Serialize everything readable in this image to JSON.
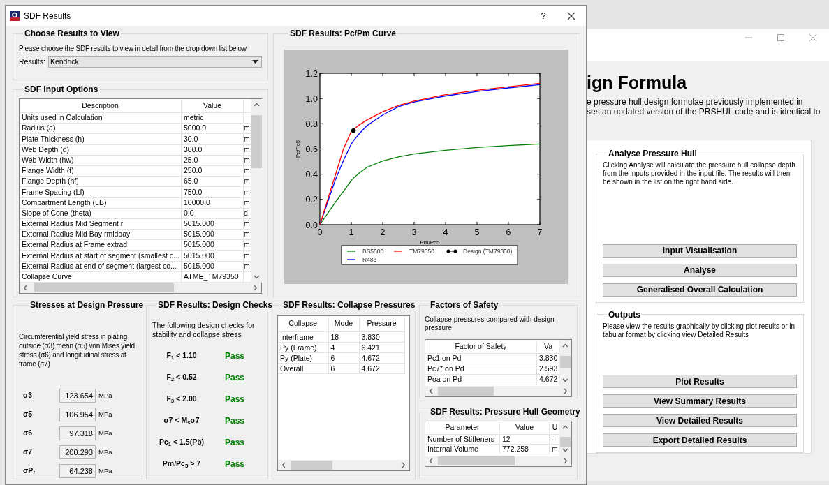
{
  "main_window": {
    "heading": "ign Formula",
    "description_lines": [
      "e pressure hull design formulae previously implemented in",
      "ses an updated version of the PRSHUL code and is identical to"
    ],
    "analyse": {
      "title": "Analyse Pressure Hull",
      "description": "Clicking Analyse will calculate the pressure hull collapse depth from the inputs provided in the input file. The results will then be shown in the list on the right hand side.",
      "buttons": [
        "Input Visualisation",
        "Analyse",
        "Generalised Overall Calculation"
      ]
    },
    "outputs": {
      "title": "Outputs",
      "description": "Please view the results graphically by clicking plot results or in tabular format by clicking view Detailed Results",
      "buttons": [
        "Plot Results",
        "View Summary Results",
        "View Detailed Results",
        "Export Detailed Results"
      ]
    }
  },
  "sdf_window": {
    "title": "SDF Results",
    "help": "?",
    "choose": {
      "title": "Choose Results to View",
      "description": "Please choose the SDF results to view in detail from the drop down list below",
      "results_label": "Results:",
      "results_value": "Kendrick"
    },
    "input_options": {
      "title": "SDF Input Options",
      "columns": [
        "Description",
        "Value"
      ],
      "rows": [
        {
          "description": "Units used in Calculation",
          "value": "metric"
        },
        {
          "description": "Radius (a)",
          "value": "5000.0",
          "unit": "m"
        },
        {
          "description": "Plate Thickness (h)",
          "value": "30.0",
          "unit": "m"
        },
        {
          "description": "Web Depth (d)",
          "value": "300.0",
          "unit": "m"
        },
        {
          "description": "Web Width (hw)",
          "value": "25.0",
          "unit": "m"
        },
        {
          "description": "Flange Width (f)",
          "value": "250.0",
          "unit": "m"
        },
        {
          "description": "Flange Depth (hf)",
          "value": "65.0",
          "unit": "m"
        },
        {
          "description": "Frame Spacing (Lf)",
          "value": "750.0",
          "unit": "m"
        },
        {
          "description": "Compartment Length (LB)",
          "value": "10000.0",
          "unit": "m"
        },
        {
          "description": "Slope of Cone (theta)",
          "value": "0.0",
          "unit": "d"
        },
        {
          "description": "External Radius Mid Segment r",
          "value": "5015.000",
          "unit": "m"
        },
        {
          "description": "External Radius Mid Bay rmidbay",
          "value": "5015.000",
          "unit": "m"
        },
        {
          "description": "External Radius at Frame extrad",
          "value": "5015.000",
          "unit": "m"
        },
        {
          "description": "External Radius at start of segment (smallest c...",
          "value": "5015.000",
          "unit": "m"
        },
        {
          "description": "External Radius at end of segment (largest co...",
          "value": "5015.000",
          "unit": "m"
        },
        {
          "description": "Collapse Curve",
          "value": "ATME_TM79350"
        }
      ]
    },
    "curve": {
      "title": "SDF Results: Pc/Pm Curve",
      "chart_data": {
        "type": "line",
        "xlabel": "Pm/Pc5",
        "ylabel": "Pc/Pc5",
        "x": [
          0,
          0.5,
          0.75,
          1,
          1.07,
          1.25,
          1.5,
          2,
          2.5,
          3,
          4,
          5,
          6,
          7
        ],
        "series": [
          {
            "name": "BS5500",
            "color": "#008000",
            "values": [
              0,
              0.18,
              0.265,
              0.35,
              0.37,
              0.41,
              0.455,
              0.505,
              0.537,
              0.56,
              0.59,
              0.612,
              0.627,
              0.64
            ]
          },
          {
            "name": "R483",
            "color": "#0000ff",
            "values": [
              0,
              0.36,
              0.51,
              0.64,
              0.665,
              0.72,
              0.785,
              0.87,
              0.935,
              0.972,
              1.02,
              1.055,
              1.084,
              1.11
            ]
          },
          {
            "name": "TM79350",
            "color": "#ff0000",
            "values": [
              0,
              0.4,
              0.6,
              0.74,
              0.755,
              0.79,
              0.83,
              0.895,
              0.945,
              0.98,
              1.03,
              1.065,
              1.093,
              1.12
            ]
          },
          {
            "name": "Design (TM79350)",
            "color": "#000000",
            "marker": "o",
            "values": [
              null,
              null,
              null,
              null,
              0.745,
              null,
              null,
              null,
              null,
              null,
              null,
              null,
              null,
              null
            ]
          }
        ],
        "legend": true,
        "xlim": [
          0,
          7
        ],
        "ylim": [
          0,
          1.2
        ],
        "xticks": [
          0,
          1,
          2,
          3,
          4,
          5,
          6,
          7
        ],
        "yticks": [
          {
            "value": 0,
            "label": "0.0"
          },
          {
            "value": 0.2,
            "label": "0.2"
          },
          {
            "value": 0.4,
            "label": "0.4"
          },
          {
            "value": 0.6,
            "label": "0.6"
          },
          {
            "value": 0.8,
            "label": "0.8"
          },
          {
            "value": 1,
            "label": "1.0"
          },
          {
            "value": 1.2,
            "label": "1.2"
          }
        ]
      }
    },
    "stresses": {
      "title": "Stresses at Design Pressure",
      "description": "Circumferential yield stress in plating outside (σ3) mean (σ5) von Mises yield stress (σ6) and longitudinal stress at frame (σ7)",
      "rows": [
        {
          "label": "σ3",
          "value": "123.654",
          "unit": "MPa"
        },
        {
          "label": "σ5",
          "value": "106.954",
          "unit": "MPa"
        },
        {
          "label": "σ6",
          "value": "97.318",
          "unit": "MPa"
        },
        {
          "label": "σ7",
          "value": "200.293",
          "unit": "MPa"
        },
        {
          "label": "σP$_{f}$",
          "value": "64.238",
          "unit": "MPa"
        }
      ]
    },
    "design_checks": {
      "title": "SDF Results: Design Checks",
      "description": "The following design checks for stability and collapse stress",
      "checks": [
        {
          "label": "F$_{1}$ < 1.10",
          "result": "Pass"
        },
        {
          "label": "F$_{2}$ < 0.52",
          "result": "Pass"
        },
        {
          "label": "F$_{3}$ < 2.00",
          "result": "Pass"
        },
        {
          "label": "σ7 < M$_{s}$σ7",
          "result": "Pass"
        },
        {
          "label": "Pc$_{1}$ < 1.5(Pb)",
          "result": "Pass"
        },
        {
          "label": "Pm/Pc$_{5}$ > 7",
          "result": "Pass"
        }
      ]
    },
    "collapse": {
      "title": "SDF Results: Collapse Pressures",
      "columns": [
        "Collapse",
        "Mode",
        "Pressure"
      ],
      "rows": [
        [
          "Interframe",
          "18",
          "3.830"
        ],
        [
          "Py (Frame)",
          "4",
          "6.421"
        ],
        [
          "Py (Plate)",
          "6",
          "4.672"
        ],
        [
          "Overall",
          "6",
          "4.672"
        ]
      ]
    },
    "safety": {
      "title": "Factors of Safety",
      "description": "Collapse pressures compared with design pressure",
      "columns": [
        "Factor of Safety",
        "Va"
      ],
      "rows": [
        [
          "Pc1 on Pd",
          "3.830"
        ],
        [
          "Pc7* on Pd",
          "2.593"
        ],
        [
          "Poa on Pd",
          "4.672"
        ]
      ]
    },
    "geometry": {
      "title": "SDF Results: Pressure Hull Geometry",
      "columns": [
        "Parameter",
        "Value",
        "U"
      ],
      "rows": [
        [
          "Number of Stiffeners",
          "12",
          "-"
        ],
        [
          "Internal Volume",
          "772.258",
          "m"
        ]
      ]
    }
  }
}
